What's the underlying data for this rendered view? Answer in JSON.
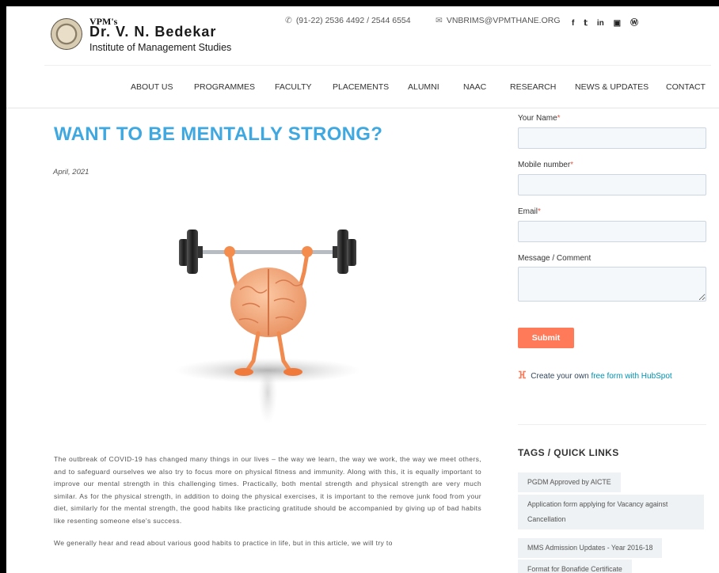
{
  "header": {
    "logo": {
      "vpm": "VPM's",
      "name": "Dr. V. N. Bedekar",
      "institute": "Institute of Management Studies"
    },
    "phone": "(91-22) 2536 4492 / 2544 6554",
    "email": "VNBRIMS@VPMTHANE.ORG",
    "social": [
      "f",
      "t",
      "in",
      "yt",
      "wp"
    ]
  },
  "nav": {
    "items": [
      "ABOUT US",
      "PROGRAMMES",
      "FACULTY",
      "PLACEMENTS",
      "ALUMNI",
      "NAAC",
      "RESEARCH",
      "NEWS & UPDATES",
      "CONTACT"
    ]
  },
  "article": {
    "title": "WANT TO BE MENTALLY STRONG?",
    "date": "April, 2021",
    "paragraphs": [
      "The outbreak of COVID-19 has changed many things in our lives – the way we learn, the way we work, the way we meet others, and to safeguard ourselves we also try to focus more on physical fitness and immunity. Along with this, it is equally important to improve our mental strength in this challenging times. Practically, both mental strength and physical strength are very much similar. As for the physical strength, in addition to doing the physical exercises, it is important to the remove junk food from your diet, similarly for the mental strength, the good habits like practicing gratitude should be accompanied by giving up of bad habits like resenting someone else's success.",
      "We generally hear and read about various good habits to practice in life, but in this article, we will try to"
    ]
  },
  "form": {
    "fields": [
      {
        "label": "Your Name",
        "required": "*"
      },
      {
        "label": "Mobile number",
        "required": "*"
      },
      {
        "label": "Email",
        "required": "*"
      },
      {
        "label": "Message / Comment",
        "required": ""
      }
    ],
    "submit_label": "Submit",
    "hubspot_prefix": "Create your own",
    "hubspot_link": "free form with HubSpot"
  },
  "tags": {
    "heading": "TAGS / QUICK LINKS",
    "items": [
      "PGDM Approved by AICTE",
      "Application form applying for Vacancy against Cancellation",
      "MMS Admission Updates - Year 2016-18",
      "Format for Bonafide Certificate"
    ]
  },
  "colors": {
    "title_blue": "#3fa8e0",
    "submit_orange": "#ff7a59",
    "input_bg": "#f5f8fa",
    "tag_bg": "#eef2f4"
  }
}
